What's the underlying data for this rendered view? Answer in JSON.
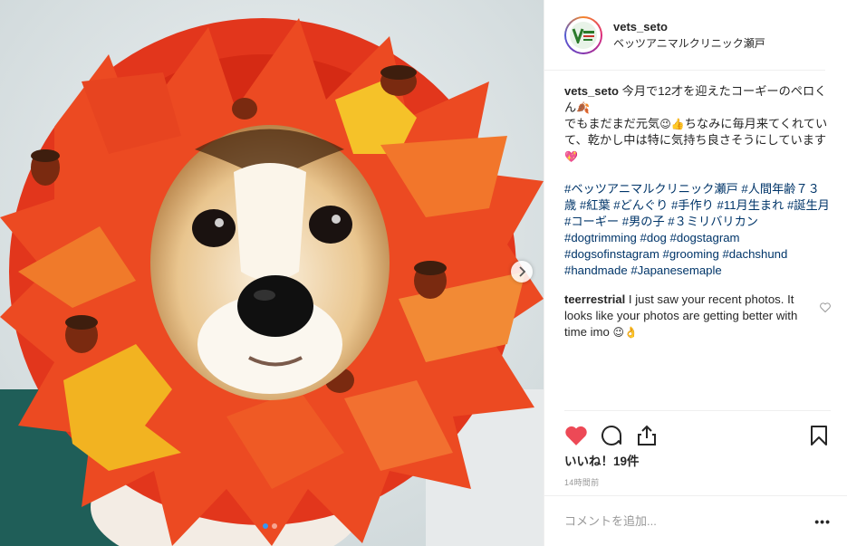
{
  "photo": {
    "alt": "",
    "carousel_next_icon": "chevron-right-icon",
    "slide_count": 2,
    "active_slide": 1
  },
  "header": {
    "username": "vets_seto",
    "location": "ベッツアニマルクリニック瀬戸",
    "avatar_icon": "clinic-logo-icon"
  },
  "caption": {
    "username": "vets_seto",
    "text_line1": "今月で12才を迎えたコーギーのペロくん",
    "emoji1": "🍂",
    "text_line2": "でもまだまだ元気",
    "emoji2": "😉👍",
    "text_line3": "ちなみに毎月来てくれていて、乾かし中は特に気持ち良さそうにしています",
    "emoji3": "💖",
    "hashtags": "#ベッツアニマルクリニック瀬戸 #人間年齢７３歳 #紅葉 #どんぐり #手作り #11月生まれ #誕生月 #コーギー #男の子 #３ミリバリカン #dogtrimming #dog #dogstagram #dogsofinstagram #grooming #dachshund #handmade #Japanesemaple"
  },
  "comment": {
    "username": "teerrestrial",
    "text": "I just saw your recent photos. It looks like your photos are getting better with time imo",
    "emoji": "😉👌"
  },
  "actions": {
    "like_icon": "heart-filled-icon",
    "comment_icon": "comment-bubble-icon",
    "share_icon": "share-icon",
    "save_icon": "bookmark-icon",
    "like_color": "#ed4956"
  },
  "likes_text": "いいね！19件",
  "timestamp": "14時間前",
  "add_comment": {
    "placeholder": "コメントを追加...",
    "more_label": "•••"
  }
}
